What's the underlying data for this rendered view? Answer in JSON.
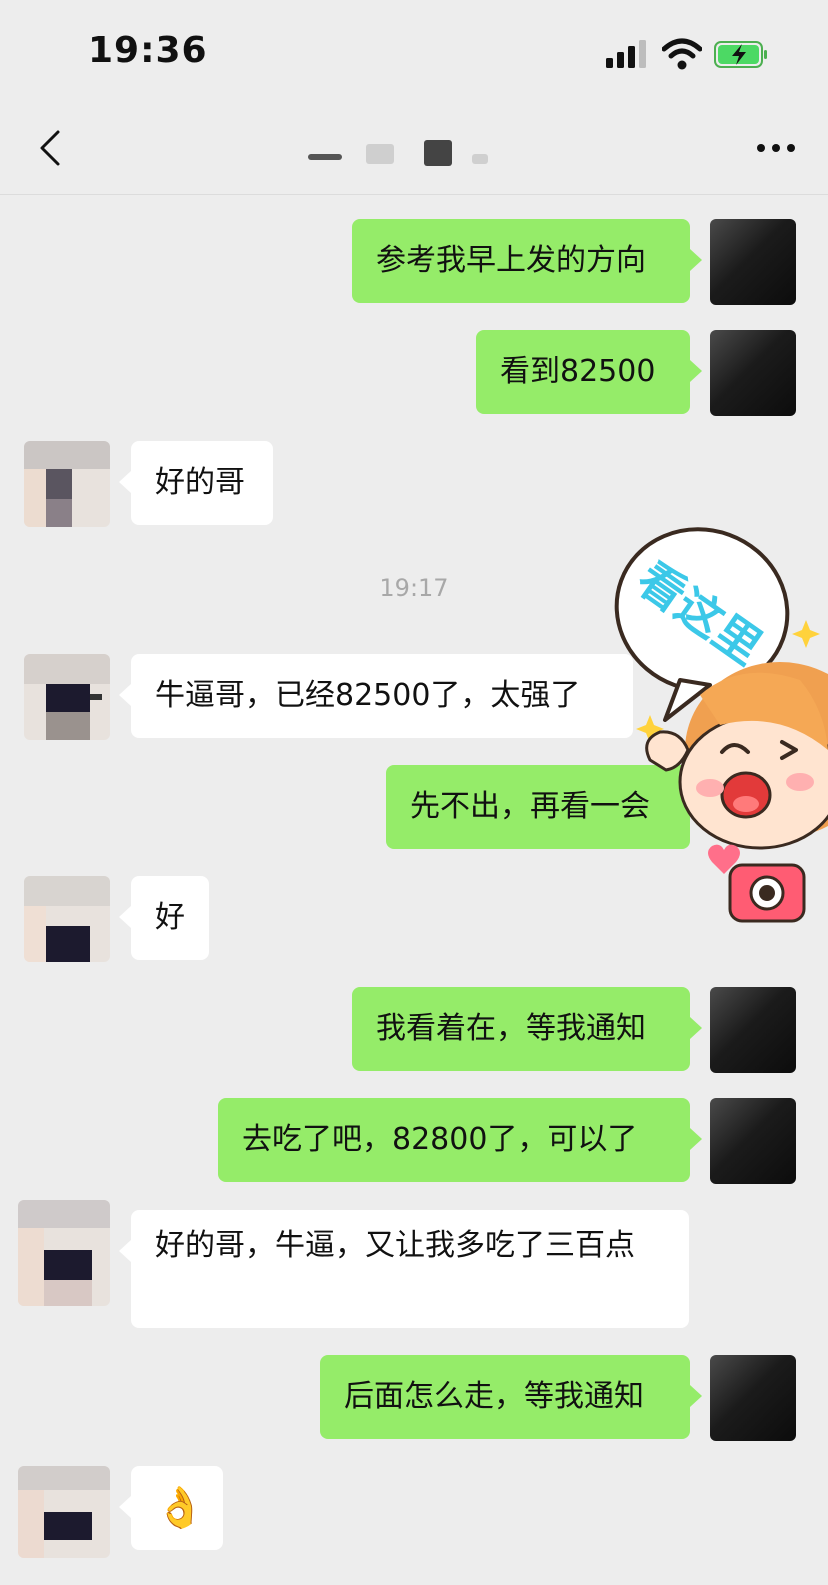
{
  "status_bar": {
    "time": "19:36",
    "icons": [
      "signal-icon",
      "wifi-icon",
      "battery-charging-icon"
    ]
  },
  "header": {
    "title": "",
    "back_icon": "chevron-left-icon",
    "more_icon": "ellipsis-icon"
  },
  "messages": [
    {
      "side": "out",
      "text": "参考我早上发的方向"
    },
    {
      "side": "out",
      "text": "看到82500"
    },
    {
      "side": "in",
      "text": "好的哥"
    },
    {
      "type": "time",
      "text": "19:17"
    },
    {
      "side": "in",
      "text": "牛逼哥，已经82500了，太强了"
    },
    {
      "side": "out",
      "text": "先不出，再看一会"
    },
    {
      "side": "in",
      "text": "好"
    },
    {
      "side": "out",
      "text": "我看着在，等我通知"
    },
    {
      "side": "out",
      "text": "去吃了吧，82800了，可以了"
    },
    {
      "side": "in",
      "text": "好的哥，牛逼，又让我多吃了三百点"
    },
    {
      "side": "out",
      "text": "后面怎么走，等我通知"
    },
    {
      "side": "in",
      "text": "👌"
    }
  ],
  "sticker": {
    "text": "看这里"
  },
  "colors": {
    "outgoing_bubble": "#95ec69",
    "incoming_bubble": "#ffffff",
    "background": "#ededed"
  }
}
